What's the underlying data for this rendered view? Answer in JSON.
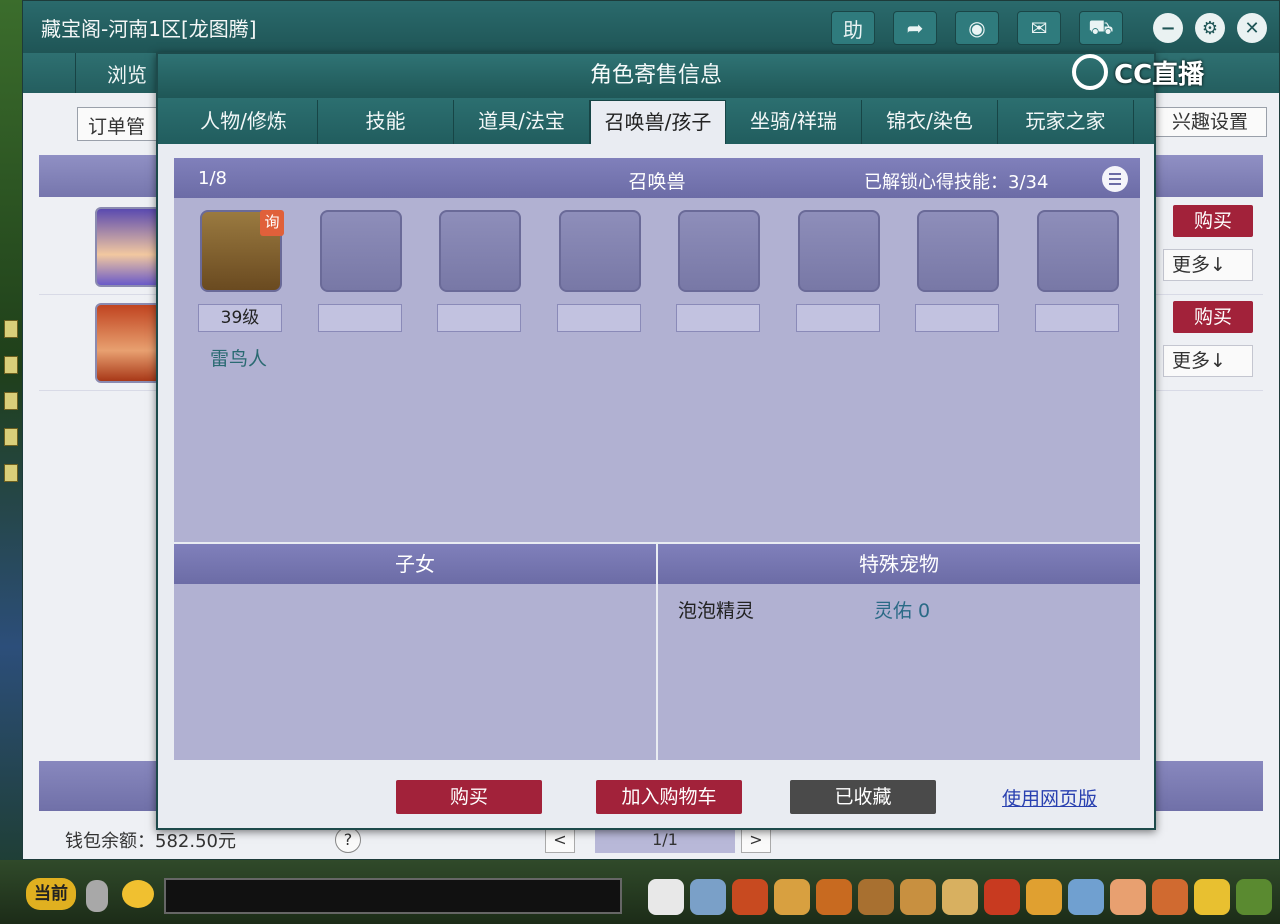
{
  "main_window": {
    "title": "藏宝阁-河南1区[龙图腾]",
    "toolbar": {
      "help_label": "助"
    },
    "nav_label": "浏览",
    "order_label": "订单管",
    "interest_label": "兴趣设置",
    "rows": [
      {
        "buy": "购买",
        "more": "更多↓"
      },
      {
        "buy": "购买",
        "more": "更多↓"
      }
    ],
    "wallet_label": "钱包余额：582.50元",
    "help_q": "?",
    "pager_prev": "<",
    "pager_next": ">",
    "pager_text": "1/1"
  },
  "dialog": {
    "title": "角色寄售信息",
    "tabs": [
      "人物/修炼",
      "技能",
      "道具/法宝",
      "召唤兽/孩子",
      "坐骑/祥瑞",
      "锦衣/染色",
      "玩家之家"
    ],
    "active_tab": "召唤兽/孩子",
    "pets": {
      "count": "1/8",
      "heading": "召唤兽",
      "skill_label": "已解锁心得技能：3/34",
      "ask_badge": "询",
      "first_level": "39级",
      "first_name": "雷鸟人"
    },
    "kids_heading": "子女",
    "special": {
      "heading": "特殊宠物",
      "name": "泡泡精灵",
      "value": "灵佑 0"
    },
    "actions": {
      "buy": "购买",
      "add_cart": "加入购物车",
      "favorited": "已收藏",
      "web": "使用网页版"
    }
  },
  "watermark": "CC直播",
  "chat": {
    "current_label": "当前"
  },
  "colors": {
    "teal_bar": "#1f5556",
    "panel": "#b1b1d2",
    "panel_header": "#6c6ca6",
    "buy_red": "#a2223a",
    "favorited_grey": "#4a4a4a",
    "link_blue": "#2940b0"
  }
}
